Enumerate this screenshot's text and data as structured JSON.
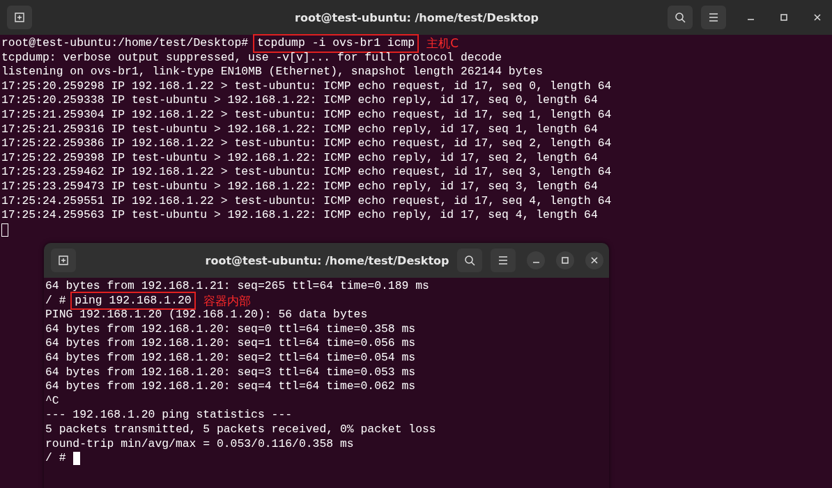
{
  "windows": [
    {
      "title": "root@test-ubuntu: /home/test/Desktop",
      "focused": false,
      "lines": [
        {
          "prompt": "root@test-ubuntu:/home/test/Desktop# ",
          "command": "tcpdump -i ovs-br1 icmp",
          "note": "主机C"
        },
        {
          "text": "tcpdump: verbose output suppressed, use -v[v]... for full protocol decode"
        },
        {
          "text": "listening on ovs-br1, link-type EN10MB (Ethernet), snapshot length 262144 bytes"
        },
        {
          "text": "17:25:20.259298 IP 192.168.1.22 > test-ubuntu: ICMP echo request, id 17, seq 0, length 64"
        },
        {
          "text": "17:25:20.259338 IP test-ubuntu > 192.168.1.22: ICMP echo reply, id 17, seq 0, length 64"
        },
        {
          "text": "17:25:21.259304 IP 192.168.1.22 > test-ubuntu: ICMP echo request, id 17, seq 1, length 64"
        },
        {
          "text": "17:25:21.259316 IP test-ubuntu > 192.168.1.22: ICMP echo reply, id 17, seq 1, length 64"
        },
        {
          "text": "17:25:22.259386 IP 192.168.1.22 > test-ubuntu: ICMP echo request, id 17, seq 2, length 64"
        },
        {
          "text": "17:25:22.259398 IP test-ubuntu > 192.168.1.22: ICMP echo reply, id 17, seq 2, length 64"
        },
        {
          "text": "17:25:23.259462 IP 192.168.1.22 > test-ubuntu: ICMP echo request, id 17, seq 3, length 64"
        },
        {
          "text": "17:25:23.259473 IP test-ubuntu > 192.168.1.22: ICMP echo reply, id 17, seq 3, length 64"
        },
        {
          "text": "17:25:24.259551 IP 192.168.1.22 > test-ubuntu: ICMP echo request, id 17, seq 4, length 64"
        },
        {
          "text": "17:25:24.259563 IP test-ubuntu > 192.168.1.22: ICMP echo reply, id 17, seq 4, length 64"
        }
      ]
    },
    {
      "title": "root@test-ubuntu: /home/test/Desktop",
      "focused": true,
      "lines": [
        {
          "text": "64 bytes from 192.168.1.21: seq=265 ttl=64 time=0.189 ms"
        },
        {
          "prompt": "/ # ",
          "command": "ping 192.168.1.20",
          "note": "容器内部"
        },
        {
          "text": "PING 192.168.1.20 (192.168.1.20): 56 data bytes"
        },
        {
          "text": "64 bytes from 192.168.1.20: seq=0 ttl=64 time=0.358 ms"
        },
        {
          "text": "64 bytes from 192.168.1.20: seq=1 ttl=64 time=0.056 ms"
        },
        {
          "text": "64 bytes from 192.168.1.20: seq=2 ttl=64 time=0.054 ms"
        },
        {
          "text": "64 bytes from 192.168.1.20: seq=3 ttl=64 time=0.053 ms"
        },
        {
          "text": "64 bytes from 192.168.1.20: seq=4 ttl=64 time=0.062 ms"
        },
        {
          "text": "^C"
        },
        {
          "text": "--- 192.168.1.20 ping statistics ---"
        },
        {
          "text": "5 packets transmitted, 5 packets received, 0% packet loss"
        },
        {
          "text": "round-trip min/avg/max = 0.053/0.116/0.358 ms"
        }
      ],
      "cursor_prompt": "/ #"
    }
  ]
}
